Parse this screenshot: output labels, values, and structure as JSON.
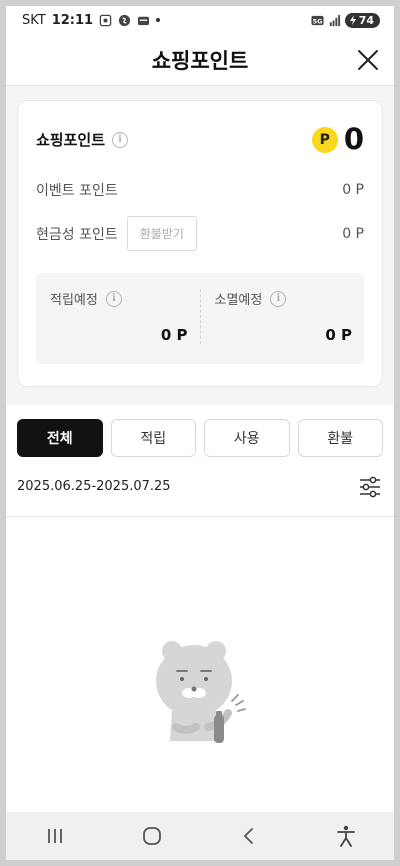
{
  "status_bar": {
    "carrier": "SKT",
    "time": "12:11",
    "network": "5G",
    "battery": "74"
  },
  "header": {
    "title": "쇼핑포인트",
    "close_icon": "close-icon"
  },
  "summary": {
    "total_label": "쇼핑포인트",
    "badge": "P",
    "total_value": "0",
    "event_points": {
      "label": "이벤트 포인트",
      "value": "0 P"
    },
    "cash_points": {
      "label": "현금성 포인트",
      "refund_button": "환불받기",
      "value": "0 P"
    },
    "scheduled": {
      "label": "적립예정",
      "value": "0 P"
    },
    "expiring": {
      "label": "소멸예정",
      "value": "0 P"
    }
  },
  "tabs": [
    {
      "label": "전체",
      "active": true
    },
    {
      "label": "적립",
      "active": false
    },
    {
      "label": "사용",
      "active": false
    },
    {
      "label": "환불",
      "active": false
    }
  ],
  "date_range": {
    "start": "2025.06.25",
    "separator": "-",
    "end": "2025.07.25",
    "filter_icon": "filter-sliders-icon"
  },
  "empty_state": {
    "illustration": "ryan-bear-illustration"
  },
  "nav_bar": {
    "recent_icon": "recent-apps-icon",
    "home_icon": "home-icon",
    "back_icon": "back-icon",
    "accessibility_icon": "accessibility-icon"
  },
  "colors": {
    "badge": "#f9d71c",
    "active_tab": "#111111",
    "section_bg": "#f5f5f5"
  }
}
